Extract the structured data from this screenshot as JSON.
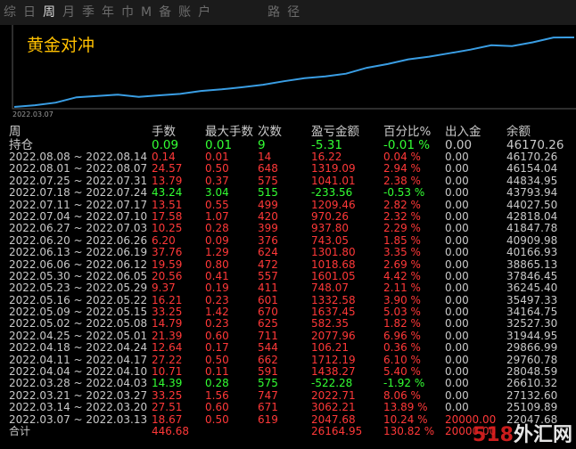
{
  "tabs": [
    "综",
    "日",
    "周",
    "月",
    "季",
    "年",
    "巾",
    "M",
    "备",
    "账",
    "户",
    "路",
    "径"
  ],
  "active_tab": 2,
  "chart": {
    "title": "黄金对冲",
    "start_date": "2022.03.07",
    "line_color": "#3a9ee4",
    "title_color": "#ffc000",
    "equity": [
      27132.6,
      27600,
      28300,
      29760,
      30100,
      30500,
      29900,
      30300,
      30700,
      31500,
      31944,
      32527,
      33200,
      34164,
      35000,
      35497,
      36245,
      37846,
      38865,
      40166,
      40909,
      41847,
      42818,
      44027,
      43793,
      44834,
      46154,
      46170
    ]
  },
  "table": {
    "headers": [
      "周",
      "手数",
      "最大手数",
      "次数",
      "盈亏金额",
      "百分比%",
      "出入金",
      "余额"
    ],
    "hold": {
      "label": "持仓",
      "lots": "0.09",
      "max": "0.01",
      "count": "9",
      "pnl": "-5.31",
      "pct": "-0.01 %",
      "io": "0.00",
      "bal": "46170.26",
      "sign": "neg"
    },
    "rows": [
      {
        "period": "2022.08.08 ~ 2022.08.14",
        "lots": "0.14",
        "max": "0.01",
        "count": "14",
        "pnl": "16.22",
        "pct": "0.04 %",
        "io": "0.00",
        "bal": "46170.26",
        "sign": "pos"
      },
      {
        "period": "2022.08.01 ~ 2022.08.07",
        "lots": "24.57",
        "max": "0.50",
        "count": "648",
        "pnl": "1319.09",
        "pct": "2.94 %",
        "io": "0.00",
        "bal": "46154.04",
        "sign": "pos"
      },
      {
        "period": "2022.07.25 ~ 2022.07.31",
        "lots": "13.79",
        "max": "0.37",
        "count": "575",
        "pnl": "1041.01",
        "pct": "2.38 %",
        "io": "0.00",
        "bal": "44834.95",
        "sign": "pos"
      },
      {
        "period": "2022.07.18 ~ 2022.07.24",
        "lots": "43.24",
        "max": "3.04",
        "count": "515",
        "pnl": "-233.56",
        "pct": "-0.53 %",
        "io": "0.00",
        "bal": "43793.94",
        "sign": "neg"
      },
      {
        "period": "2022.07.11 ~ 2022.07.17",
        "lots": "13.51",
        "max": "0.55",
        "count": "499",
        "pnl": "1209.46",
        "pct": "2.82 %",
        "io": "0.00",
        "bal": "44027.50",
        "sign": "pos"
      },
      {
        "period": "2022.07.04 ~ 2022.07.10",
        "lots": "17.58",
        "max": "1.07",
        "count": "420",
        "pnl": "970.26",
        "pct": "2.32 %",
        "io": "0.00",
        "bal": "42818.04",
        "sign": "pos"
      },
      {
        "period": "2022.06.27 ~ 2022.07.03",
        "lots": "10.25",
        "max": "0.28",
        "count": "399",
        "pnl": "937.80",
        "pct": "2.29 %",
        "io": "0.00",
        "bal": "41847.78",
        "sign": "pos"
      },
      {
        "period": "2022.06.20 ~ 2022.06.26",
        "lots": "6.20",
        "max": "0.09",
        "count": "376",
        "pnl": "743.05",
        "pct": "1.85 %",
        "io": "0.00",
        "bal": "40909.98",
        "sign": "pos"
      },
      {
        "period": "2022.06.13 ~ 2022.06.19",
        "lots": "37.76",
        "max": "1.29",
        "count": "624",
        "pnl": "1301.80",
        "pct": "3.35 %",
        "io": "0.00",
        "bal": "40166.93",
        "sign": "pos"
      },
      {
        "period": "2022.06.06 ~ 2022.06.12",
        "lots": "19.59",
        "max": "0.80",
        "count": "472",
        "pnl": "1018.68",
        "pct": "2.69 %",
        "io": "0.00",
        "bal": "38865.13",
        "sign": "pos"
      },
      {
        "period": "2022.05.30 ~ 2022.06.05",
        "lots": "20.56",
        "max": "0.41",
        "count": "557",
        "pnl": "1601.05",
        "pct": "4.42 %",
        "io": "0.00",
        "bal": "37846.45",
        "sign": "pos"
      },
      {
        "period": "2022.05.23 ~ 2022.05.29",
        "lots": "9.37",
        "max": "0.19",
        "count": "411",
        "pnl": "748.07",
        "pct": "2.11 %",
        "io": "0.00",
        "bal": "36245.40",
        "sign": "pos"
      },
      {
        "period": "2022.05.16 ~ 2022.05.22",
        "lots": "16.21",
        "max": "0.23",
        "count": "601",
        "pnl": "1332.58",
        "pct": "3.90 %",
        "io": "0.00",
        "bal": "35497.33",
        "sign": "pos"
      },
      {
        "period": "2022.05.09 ~ 2022.05.15",
        "lots": "33.25",
        "max": "1.42",
        "count": "670",
        "pnl": "1637.45",
        "pct": "5.03 %",
        "io": "0.00",
        "bal": "34164.75",
        "sign": "pos"
      },
      {
        "period": "2022.05.02 ~ 2022.05.08",
        "lots": "14.79",
        "max": "0.23",
        "count": "625",
        "pnl": "582.35",
        "pct": "1.82 %",
        "io": "0.00",
        "bal": "32527.30",
        "sign": "pos"
      },
      {
        "period": "2022.04.25 ~ 2022.05.01",
        "lots": "21.39",
        "max": "0.60",
        "count": "711",
        "pnl": "2077.96",
        "pct": "6.96 %",
        "io": "0.00",
        "bal": "31944.95",
        "sign": "pos"
      },
      {
        "period": "2022.04.18 ~ 2022.04.24",
        "lots": "12.64",
        "max": "0.17",
        "count": "544",
        "pnl": "106.21",
        "pct": "0.36 %",
        "io": "0.00",
        "bal": "29866.99",
        "sign": "pos"
      },
      {
        "period": "2022.04.11 ~ 2022.04.17",
        "lots": "27.22",
        "max": "0.50",
        "count": "662",
        "pnl": "1712.19",
        "pct": "6.10 %",
        "io": "0.00",
        "bal": "29760.78",
        "sign": "pos"
      },
      {
        "period": "2022.04.04 ~ 2022.04.10",
        "lots": "10.71",
        "max": "0.11",
        "count": "591",
        "pnl": "1438.27",
        "pct": "5.40 %",
        "io": "0.00",
        "bal": "28048.59",
        "sign": "pos"
      },
      {
        "period": "2022.03.28 ~ 2022.04.03",
        "lots": "14.39",
        "max": "0.28",
        "count": "575",
        "pnl": "-522.28",
        "pct": "-1.92 %",
        "io": "0.00",
        "bal": "26610.32",
        "sign": "neg"
      },
      {
        "period": "2022.03.21 ~ 2022.03.27",
        "lots": "33.25",
        "max": "1.56",
        "count": "747",
        "pnl": "2022.71",
        "pct": "8.06 %",
        "io": "0.00",
        "bal": "27132.60",
        "sign": "pos"
      },
      {
        "period": "2022.03.14 ~ 2022.03.20",
        "lots": "27.51",
        "max": "0.60",
        "count": "671",
        "pnl": "3062.21",
        "pct": "13.89 %",
        "io": "0.00",
        "bal": "25109.89",
        "sign": "pos"
      },
      {
        "period": "2022.03.07 ~ 2022.03.13",
        "lots": "18.67",
        "max": "0.50",
        "count": "619",
        "pnl": "2047.68",
        "pct": "10.24 %",
        "io": "20000.00",
        "bal": "22047.68",
        "sign": "pos"
      }
    ],
    "total": {
      "label": "合计",
      "lots": "446.68",
      "pnl": "26164.95",
      "pct": "130.82 %",
      "io": "20000.00",
      "sign": "pos"
    }
  },
  "watermark": {
    "num": "518",
    "text": "外汇网"
  },
  "colors": {
    "positive": "#ff3838",
    "negative": "#33ff33",
    "neutral": "#c9c9c9"
  }
}
